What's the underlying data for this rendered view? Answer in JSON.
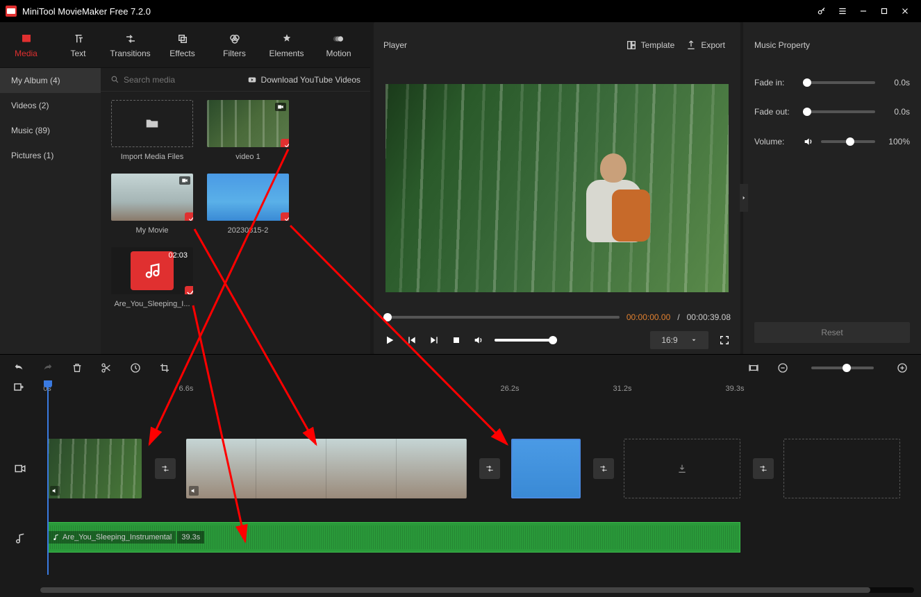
{
  "titlebar": {
    "title": "MiniTool MovieMaker Free 7.2.0"
  },
  "toolTabs": {
    "media": "Media",
    "text": "Text",
    "transitions": "Transitions",
    "effects": "Effects",
    "filters": "Filters",
    "elements": "Elements",
    "motion": "Motion"
  },
  "mediaSidebar": {
    "myAlbum": "My Album (4)",
    "videos": "Videos (2)",
    "music": "Music (89)",
    "pictures": "Pictures (1)"
  },
  "mediaTopbar": {
    "searchPlaceholder": "Search media",
    "ytDownload": "Download YouTube Videos"
  },
  "mediaItems": {
    "import": "Import Media Files",
    "video1": "video 1",
    "myMovie": "My Movie",
    "clip2": "20230815-2",
    "audioDuration": "02:03",
    "audioName": "Are_You_Sleeping_I..."
  },
  "player": {
    "title": "Player",
    "template": "Template",
    "export": "Export",
    "timeCurrent": "00:00:00.00",
    "timeSep": "/",
    "timeTotal": "00:00:39.08",
    "aspect": "16:9"
  },
  "props": {
    "header": "Music Property",
    "fadeInLabel": "Fade in:",
    "fadeInVal": "0.0s",
    "fadeOutLabel": "Fade out:",
    "fadeOutVal": "0.0s",
    "volumeLabel": "Volume:",
    "volumeVal": "100%",
    "reset": "Reset"
  },
  "ruler": {
    "t0": "0s",
    "t1": "6.6s",
    "t2": "26.2s",
    "t3": "31.2s",
    "t4": "39.3s"
  },
  "audioClip": {
    "name": "Are_You_Sleeping_Instrumental",
    "dur": "39.3s"
  }
}
